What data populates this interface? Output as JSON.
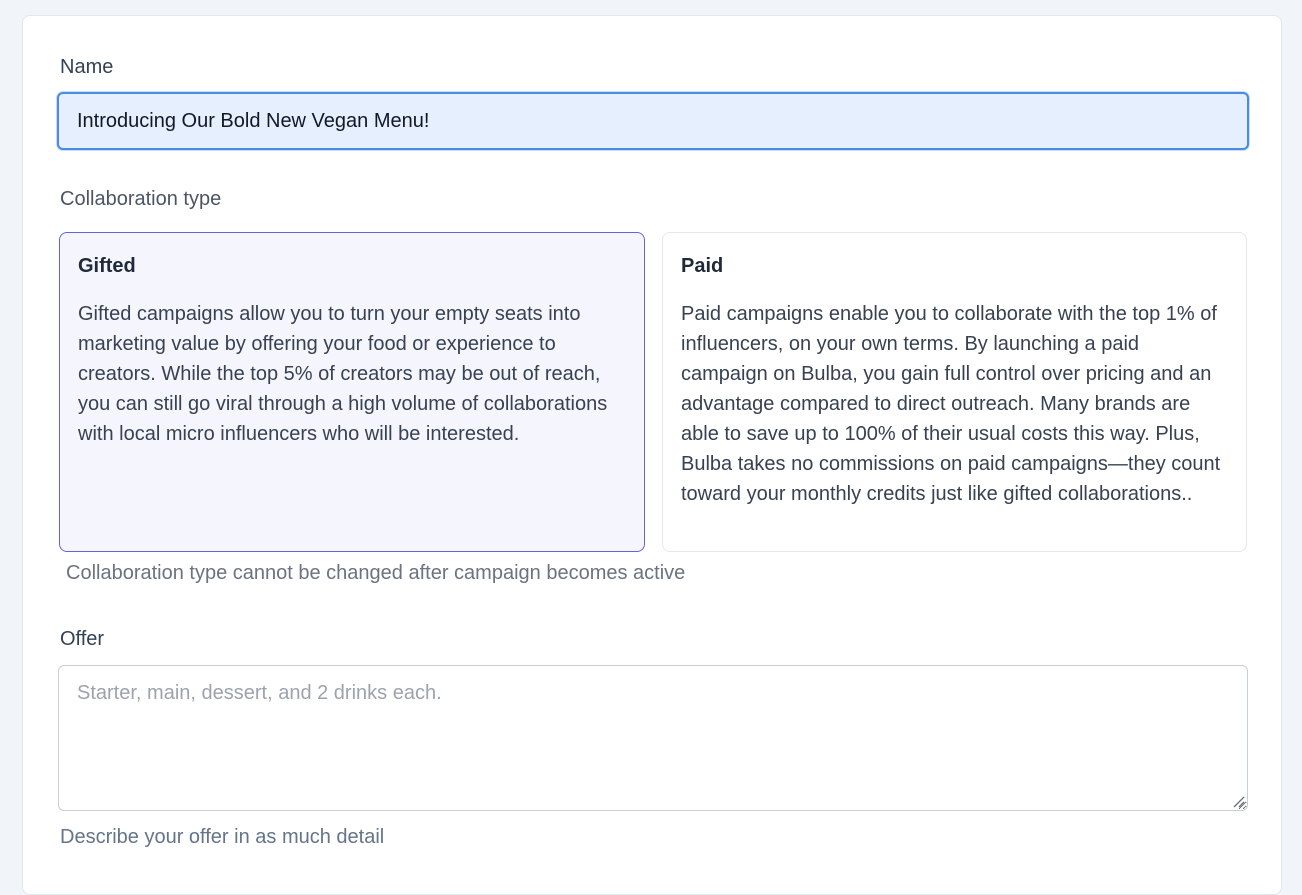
{
  "form": {
    "name": {
      "label": "Name",
      "value": "Introducing Our Bold New Vegan Menu!"
    },
    "collaboration": {
      "label": "Collaboration type",
      "selected": "Gifted",
      "options": [
        {
          "title": "Gifted",
          "description": "Gifted campaigns allow you to turn your empty seats into marketing value by offering your food or experience to creators. While the top 5% of creators may be out of reach, you can still go viral through a high volume of collaborations with local micro influencers who will be interested."
        },
        {
          "title": "Paid",
          "description": "Paid campaigns enable you to collaborate with the top 1% of influencers, on your own terms. By launching a paid campaign on Bulba, you gain full control over pricing and an advantage compared to direct outreach. Many brands are able to save up to 100% of their usual costs this way. Plus, Bulba takes no commissions on paid campaigns—they count toward your monthly credits just like gifted collaborations.."
        }
      ],
      "hint": "Collaboration type cannot be changed after campaign becomes active"
    },
    "offer": {
      "label": "Offer",
      "value": "",
      "placeholder": "Starter, main, dessert, and 2 drinks each.",
      "hint": "Describe your offer in as much detail"
    }
  },
  "colors": {
    "focus_border": "#4a8be3",
    "focus_fill": "#e5effd",
    "selected_border": "#6366d1",
    "selected_fill": "#f5f6fd"
  }
}
